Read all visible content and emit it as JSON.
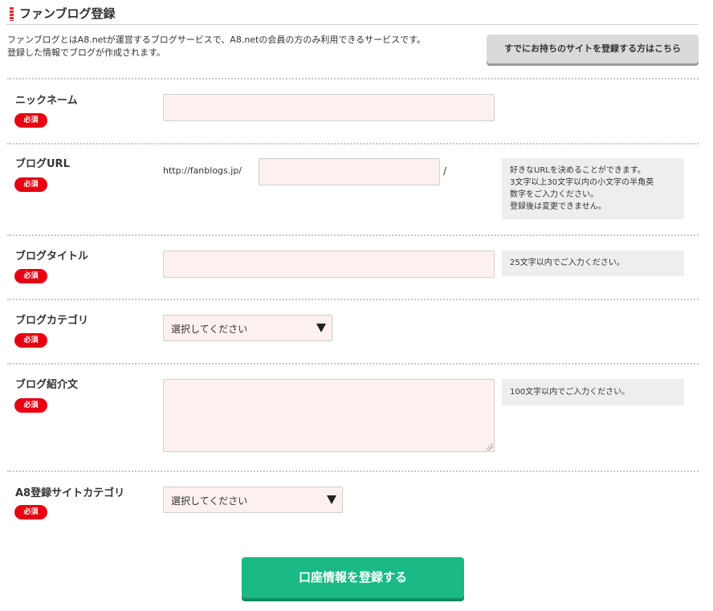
{
  "page": {
    "title": "ファンブログ登録",
    "intro_line1": "ファンブログとはA8.netが運営するブログサービスで、A8.netの会員の方のみ利用できるサービスです。",
    "intro_line2": "登録した情報でブログが作成されます。",
    "existing_site_button": "すでにお持ちのサイトを登録する方はこちら"
  },
  "required_label": "必須",
  "fields": {
    "nickname": {
      "label": "ニックネーム",
      "value": ""
    },
    "blog_url": {
      "label": "ブログURL",
      "prefix": "http://fanblogs.jp/",
      "suffix": "/",
      "value": "",
      "hint": [
        "好きなURLを決めることができます。",
        "3文字以上30文字以内の小文字の半角英",
        "数字をご入力ください。",
        "登録後は変更できません。"
      ]
    },
    "blog_title": {
      "label": "ブログタイトル",
      "value": "",
      "hint": "25文字以内でご入力ください。"
    },
    "blog_category": {
      "label": "ブログカテゴリ",
      "selected": "選択してください"
    },
    "blog_intro": {
      "label": "ブログ紹介文",
      "value": "",
      "hint": "100文字以内でご入力ください。"
    },
    "a8_site_category": {
      "label": "A8登録サイトカテゴリ",
      "selected": "選択してください"
    }
  },
  "submit_button": "口座情報を登録する",
  "colors": {
    "accent_green": "#1ab985",
    "required_red": "#e60012",
    "input_bg": "#fdf1f0",
    "hint_bg": "#eeeeee"
  },
  "icons": {
    "title_marker": "title-marker-icon",
    "dropdown": "triangle-down-icon",
    "resize": "resize-grip-icon"
  }
}
